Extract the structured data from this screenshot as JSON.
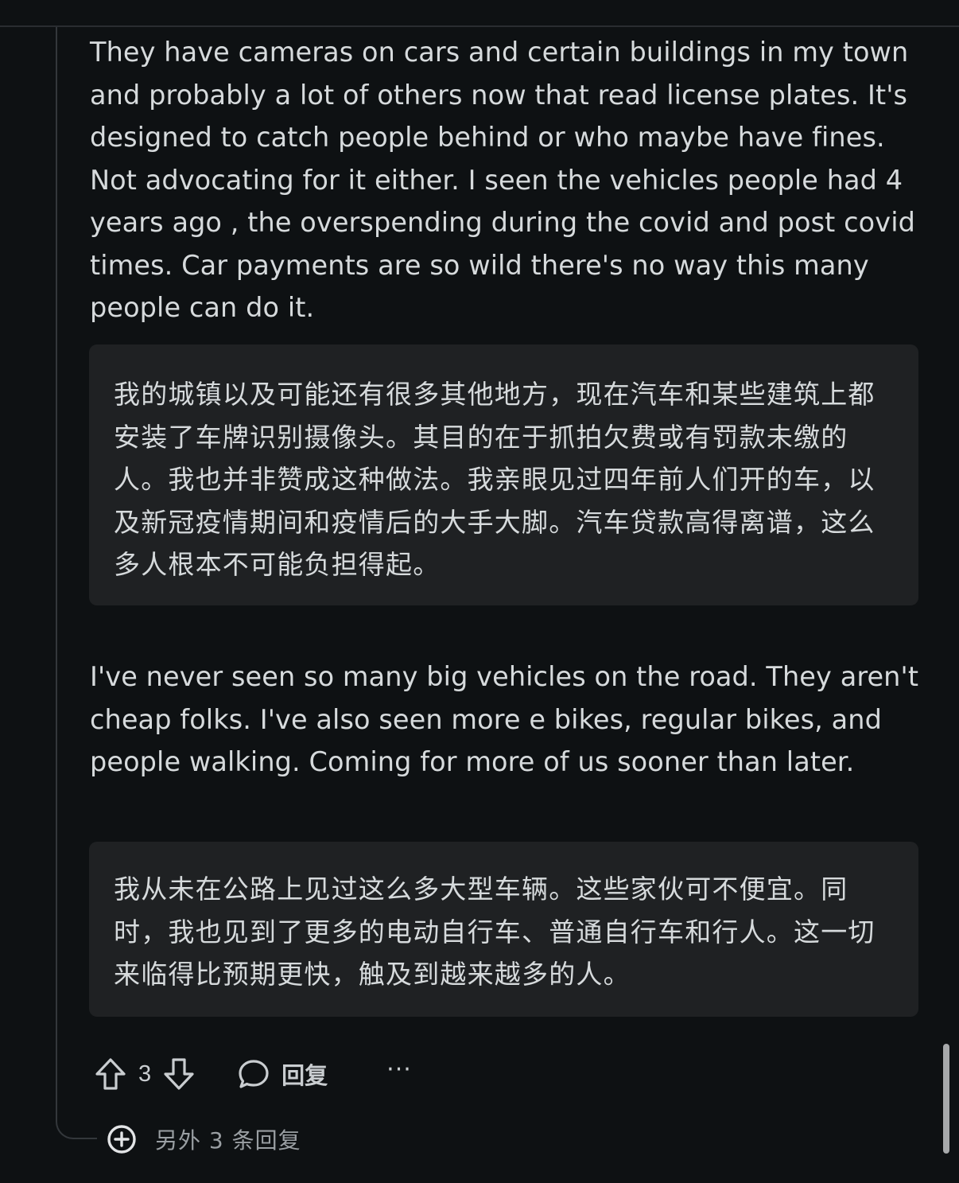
{
  "comment": {
    "paragraph1": "They have cameras on cars and certain buildings in my town and probably a lot of others now that read license plates. It's designed to catch people behind or who maybe have fines. Not advocating for it either. I seen the vehicles people had 4 years ago , the overspending during the covid and post covid times. Car payments are so wild there's no way this many people can do it.",
    "translation1": "我的城镇以及可能还有很多其他地方，现在汽车和某些建筑上都安装了车牌识别摄像头。其目的在于抓拍欠费或有罚款未缴的人。我也并非赞成这种做法。我亲眼见过四年前人们开的车，以及新冠疫情期间和疫情后的大手大脚。汽车贷款高得离谱，这么多人根本不可能负担得起。",
    "paragraph2": "I've never seen so many big vehicles on the road. They aren't cheap folks. I've also seen more e bikes, regular bikes, and people walking. Coming for more of us sooner than later.",
    "translation2": "我从未在公路上见过这么多大型车辆。这些家伙可不便宜。同时，我也见到了更多的电动自行车、普通自行车和行人。这一切来临得比预期更快，触及到越来越多的人。"
  },
  "actions": {
    "upvote_icon": "upvote-arrow-icon",
    "vote_count": "3",
    "downvote_icon": "downvote-arrow-icon",
    "reply_icon": "speech-bubble-icon",
    "reply_label": "回复",
    "more_label": "···"
  },
  "more_replies": {
    "icon": "plus-circle-icon",
    "label": "另外 3 条回复"
  },
  "colors": {
    "background": "#0e1113",
    "text": "#d6dadc",
    "translation_bg": "#1f2123",
    "muted": "#9a9fa3"
  }
}
